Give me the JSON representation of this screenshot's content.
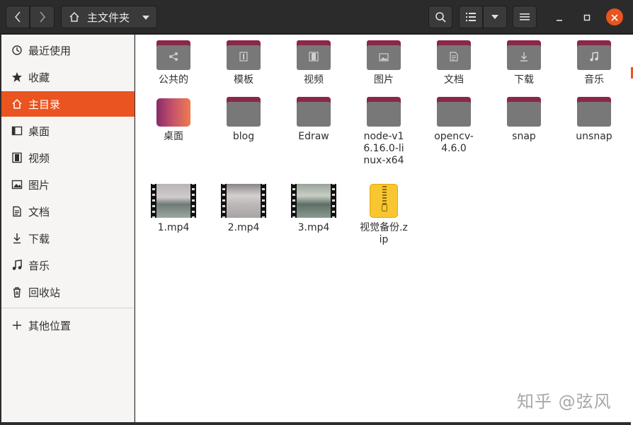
{
  "header": {
    "location_label": "主文件夹",
    "icons": {
      "back": "chevron-left-icon",
      "forward": "chevron-right-icon",
      "home": "home-icon",
      "search": "search-icon",
      "view": "list-view-icon",
      "menu": "hamburger-menu-icon"
    }
  },
  "sidebar": {
    "items": [
      {
        "label": "最近使用",
        "icon": "recent-icon"
      },
      {
        "label": "收藏",
        "icon": "star-icon"
      },
      {
        "label": "主目录",
        "icon": "home-icon",
        "active": true
      },
      {
        "label": "桌面",
        "icon": "desktop-icon"
      },
      {
        "label": "视频",
        "icon": "video-icon"
      },
      {
        "label": "图片",
        "icon": "picture-icon"
      },
      {
        "label": "文档",
        "icon": "document-icon"
      },
      {
        "label": "下载",
        "icon": "download-icon"
      },
      {
        "label": "音乐",
        "icon": "music-icon"
      },
      {
        "label": "回收站",
        "icon": "trash-icon"
      }
    ],
    "other_locations": "其他位置"
  },
  "files": [
    {
      "name": "公共的",
      "type": "folder",
      "emblem": "share"
    },
    {
      "name": "模板",
      "type": "folder",
      "emblem": "template"
    },
    {
      "name": "视频",
      "type": "folder",
      "emblem": "video"
    },
    {
      "name": "图片",
      "type": "folder",
      "emblem": "picture"
    },
    {
      "name": "文档",
      "type": "folder",
      "emblem": "document"
    },
    {
      "name": "下载",
      "type": "folder",
      "emblem": "download"
    },
    {
      "name": "音乐",
      "type": "folder",
      "emblem": "music"
    },
    {
      "name": "桌面",
      "type": "folder",
      "emblem": "desktop"
    },
    {
      "name": "blog",
      "type": "folder"
    },
    {
      "name": "Edraw",
      "type": "folder"
    },
    {
      "name": "node-v16.16.0-linux-x64",
      "type": "folder"
    },
    {
      "name": "opencv-4.6.0",
      "type": "folder"
    },
    {
      "name": "snap",
      "type": "folder"
    },
    {
      "name": "unsnap",
      "type": "folder"
    },
    {
      "name": "1.mp4",
      "type": "video"
    },
    {
      "name": "2.mp4",
      "type": "video"
    },
    {
      "name": "3.mp4",
      "type": "video"
    },
    {
      "name": "视觉备份.zip",
      "type": "archive"
    }
  ],
  "watermark": "知乎 @弦风",
  "colors": {
    "accent": "#e95420",
    "folder_tab": "#8a2847",
    "folder_body": "#787878"
  }
}
